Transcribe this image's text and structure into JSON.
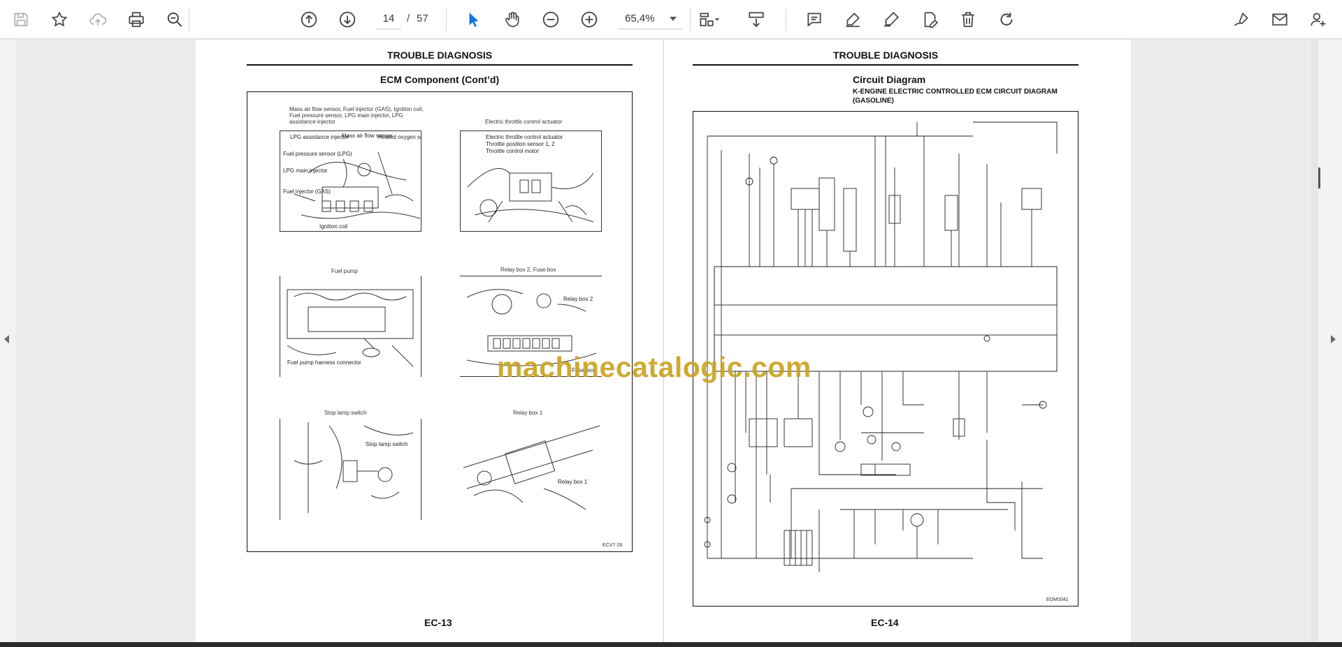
{
  "toolbar": {
    "page_current": "14",
    "page_separator": "/",
    "page_total": "57",
    "zoom": "65,4%",
    "icons": [
      "save-icon",
      "star-icon",
      "cloud-upload-icon",
      "print-icon",
      "zoom-search-icon",
      "page-up-icon",
      "page-down-icon",
      "select-cursor-icon",
      "hand-icon",
      "zoom-out-icon",
      "zoom-in-icon",
      "page-fit-icon",
      "scroll-mode-icon",
      "comment-icon",
      "highlight-icon",
      "draw-icon",
      "edit-pdf-icon",
      "delete-icon",
      "rotate-icon",
      "sign-icon",
      "mail-icon",
      "add-user-icon"
    ]
  },
  "left_page": {
    "header": "TROUBLE DIAGNOSIS",
    "subtitle": "ECM Component (Cont’d)",
    "footer": "EC-13",
    "figure_code": "ECV7-26",
    "captions": {
      "engine_top": "Mass air flow sensor, Fuel injector (GAS), Ignition coil, Fuel pressure sensor, LPG main injector, LPG assistance injector",
      "throttle": "Electric throttle control actuator",
      "fuel_pump": "Fuel pump",
      "relay_box2": "Relay box 2, Fuse box",
      "stop_lamp": "Stop lamp switch",
      "relay_box1": "Relay box 1"
    },
    "labels": {
      "lpg_assistance": "LPG assistance injector",
      "mass_air": "Mass air flow sensor",
      "heated_oxygen": "Heated oxygen sensor",
      "fuel_pressure": "Fuel pressure sensor (LPG)",
      "lpg_main": "LPG main injector",
      "fuel_injector": "Fuel injector (GAS)",
      "ignition_coil": "Ignition coil",
      "etc_actuator": "Electric throttle control actuator",
      "throttle_sensor": "Throttle position sensor 1, 2",
      "throttle_motor": "Throttle control motor",
      "fuel_pump_harness": "Fuel pump harness connector",
      "relay_box_2": "Relay box 2",
      "fuse_box": "Fuse box",
      "stop_lamp_switch": "Stop lamp switch",
      "relay_box_1": "Relay box 1"
    }
  },
  "right_page": {
    "header": "TROUBLE DIAGNOSIS",
    "subtitle": "Circuit Diagram",
    "diagram_title": "K-ENGINE ELECTRIC CONTROLLED ECM CIRCUIT DIAGRAM (GASOLINE)",
    "footer": "EC-14",
    "figure_code": "EOM0041"
  },
  "watermark": "machinecatalogic.com"
}
